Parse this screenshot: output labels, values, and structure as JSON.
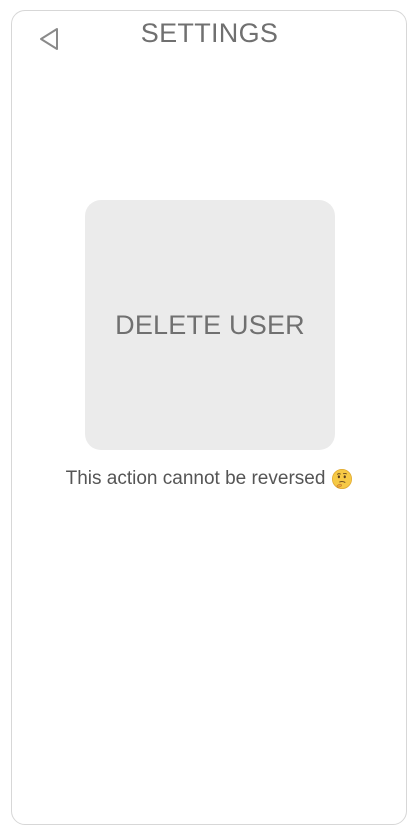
{
  "header": {
    "title": "SETTINGS",
    "back_icon": "back-triangle-icon"
  },
  "main": {
    "delete_button_label": "DELETE USER",
    "warning_text": "This action cannot be reversed",
    "warning_emoji": "thinking-face-icon"
  },
  "colors": {
    "text_gray": "#707070",
    "button_bg": "#ebebeb",
    "border": "#d7d7d7"
  }
}
